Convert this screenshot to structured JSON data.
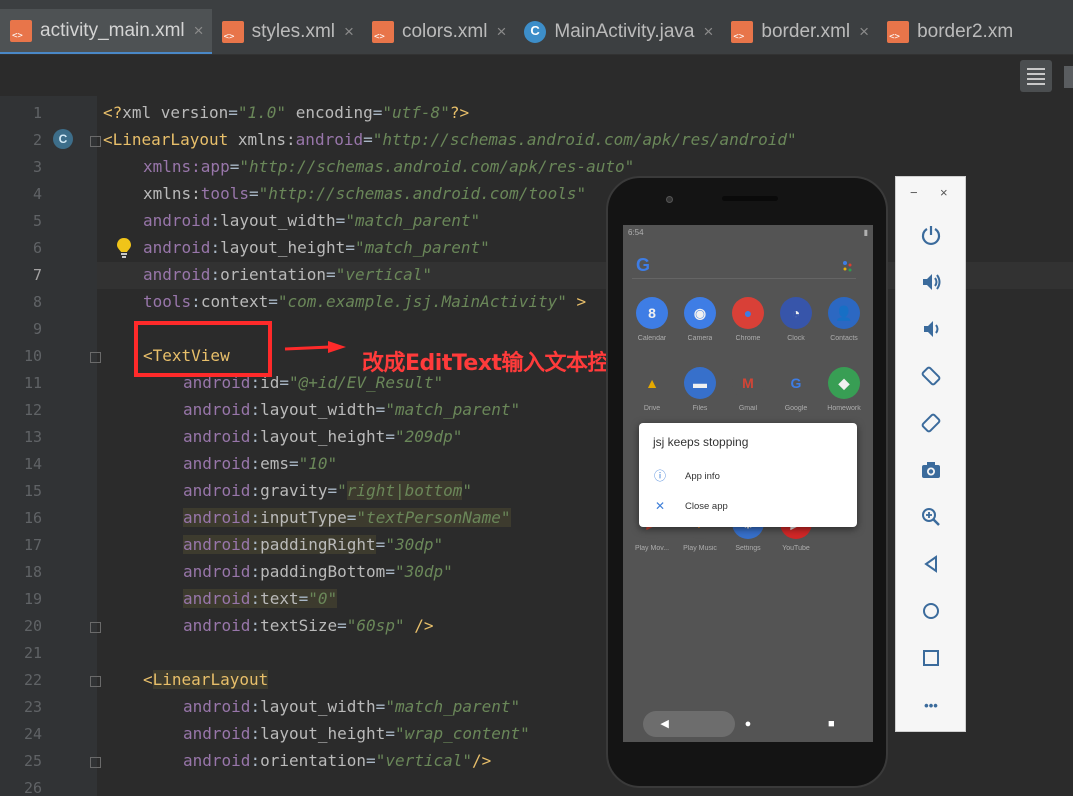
{
  "tabs": [
    {
      "label": "activity_main.xml",
      "icon": "xml-file-icon",
      "active": true
    },
    {
      "label": "styles.xml",
      "icon": "xml-file-icon",
      "active": false
    },
    {
      "label": "colors.xml",
      "icon": "xml-file-icon",
      "active": false
    },
    {
      "label": "MainActivity.java",
      "icon": "java-class-icon",
      "active": false
    },
    {
      "label": "border.xml",
      "icon": "xml-file-icon",
      "active": false
    },
    {
      "label": "border2.xm",
      "icon": "xml-file-icon",
      "active": false
    }
  ],
  "editor": {
    "line_numbers": [
      "1",
      "2",
      "3",
      "4",
      "5",
      "6",
      "7",
      "8",
      "9",
      "10",
      "11",
      "12",
      "13",
      "14",
      "15",
      "16",
      "17",
      "18",
      "19",
      "20",
      "21",
      "22",
      "23",
      "24",
      "25",
      "26"
    ],
    "gutter_badge": "C"
  },
  "annotation": {
    "text": "改成EditText输入文本控件",
    "color": "#ff2a2a"
  },
  "emulator": {
    "status_time": "6:54",
    "search_logo": "G",
    "apps_row1": [
      {
        "label": "Calendar",
        "glyph": "8",
        "bg": "#4285f4",
        "fg": "#ffffff"
      },
      {
        "label": "Camera",
        "glyph": "◉",
        "bg": "#4285f4",
        "fg": "#ffffff"
      },
      {
        "label": "Chrome",
        "glyph": "●",
        "bg": "#e7453b",
        "fg": "#4285f4"
      },
      {
        "label": "Clock",
        "glyph": "◔",
        "bg": "#3b5bb5",
        "fg": "#ffffff"
      },
      {
        "label": "Contacts",
        "glyph": "👤",
        "bg": "#2f6fcf",
        "fg": "#ffffff"
      }
    ],
    "apps_row2": [
      {
        "label": "Drive",
        "glyph": "▲",
        "bg": "#5a5a5a",
        "fg": "#f4b400"
      },
      {
        "label": "Files",
        "glyph": "▬",
        "bg": "#3b78d8",
        "fg": "#ffffff"
      },
      {
        "label": "Gmail",
        "glyph": "M",
        "bg": "#5a5a5a",
        "fg": "#e04a3a"
      },
      {
        "label": "Google",
        "glyph": "G",
        "bg": "#5a5a5a",
        "fg": "#4285f4"
      },
      {
        "label": "Homework",
        "glyph": "◆",
        "bg": "#3ca85a",
        "fg": "#ffffff"
      }
    ],
    "apps_row3": [
      {
        "label": "Play Mov...",
        "glyph": "▶",
        "bg": "#5a5a5a",
        "fg": "#e04a3a"
      },
      {
        "label": "Play Music",
        "glyph": "♪",
        "bg": "#5a5a5a",
        "fg": "#f08a30"
      },
      {
        "label": "Settings",
        "glyph": "⚙",
        "bg": "#3b78d8",
        "fg": "#ffffff"
      },
      {
        "label": "YouTube",
        "glyph": "▶",
        "bg": "#e02a2a",
        "fg": "#ffffff"
      },
      {
        "label": "",
        "glyph": "",
        "bg": "transparent",
        "fg": "#ffffff"
      }
    ],
    "dialog": {
      "title": "jsj keeps stopping",
      "app_info": "App info",
      "close_app": "Close app"
    }
  },
  "emulator_controls": {
    "minimize": "−",
    "close": "×",
    "more": "•••"
  }
}
